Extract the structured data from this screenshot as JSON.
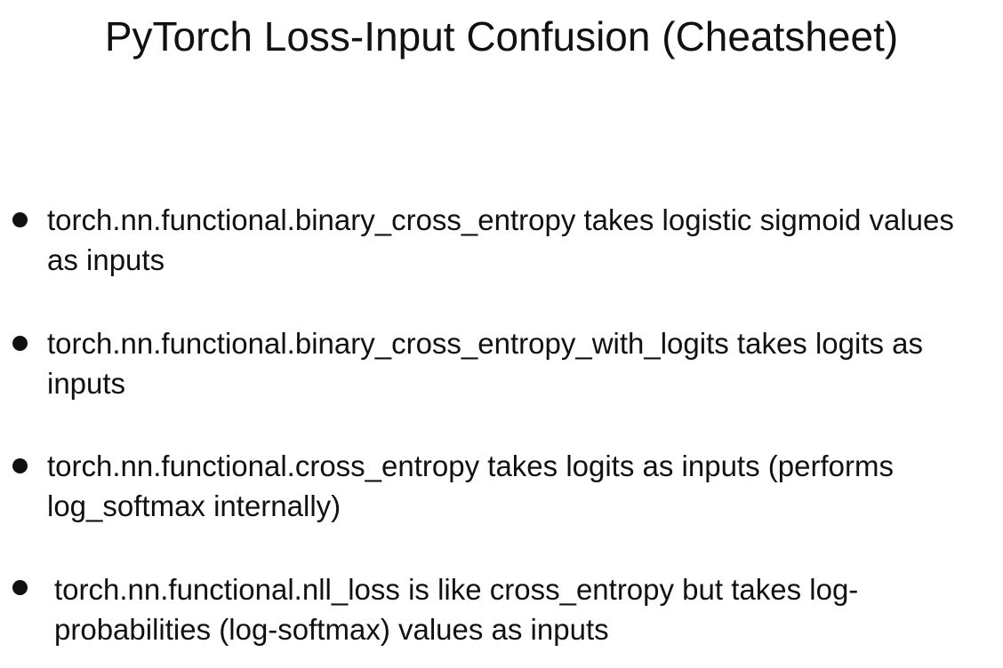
{
  "slide": {
    "title": "PyTorch Loss-Input Confusion (Cheatsheet)",
    "bullets": [
      {
        "text": "torch.nn.functional.binary_cross_entropy takes logistic sigmoid values as inputs"
      },
      {
        "text": "torch.nn.functional.binary_cross_entropy_with_logits takes logits as inputs"
      },
      {
        "text": "torch.nn.functional.cross_entropy takes logits as inputs (performs log_softmax internally)"
      },
      {
        "text": "torch.nn.functional.nll_loss is like cross_entropy but takes log-probabilities (log-softmax) values as inputs"
      }
    ]
  }
}
